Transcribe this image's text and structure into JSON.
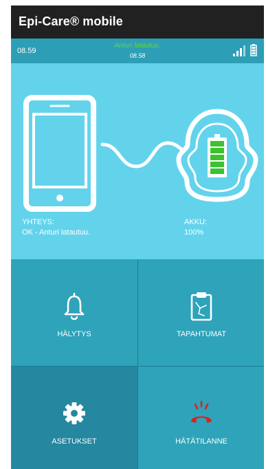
{
  "app": {
    "title": "Epi-Care® mobile"
  },
  "status": {
    "time": "08.59",
    "sensor_message": "Anturi latautuu.",
    "sensor_time": "08.58"
  },
  "connection": {
    "label": "YHTEYS:",
    "value": "OK - Anturi latautuu."
  },
  "battery": {
    "label": "AKKU:",
    "value": "100%",
    "level": 1.0
  },
  "tiles": [
    {
      "label": "HÄLYTYS",
      "icon": "bell-icon"
    },
    {
      "label": "TAPAHTUMAT",
      "icon": "clipboard-icon"
    },
    {
      "label": "ASETUKSET",
      "icon": "gear-icon"
    },
    {
      "label": "HÄTÄTILANNE",
      "icon": "phone-hangup-icon"
    }
  ],
  "colors": {
    "header_bg": "#212121",
    "status_bg": "#2c9eb6",
    "hero_bg": "#63d3ec",
    "tile_bg": "#2ea3b9",
    "tile_selected_bg": "#2587a0",
    "sensor_message": "#66d933",
    "battery_fill": "#3cc22f",
    "emergency": "#e0201b"
  }
}
